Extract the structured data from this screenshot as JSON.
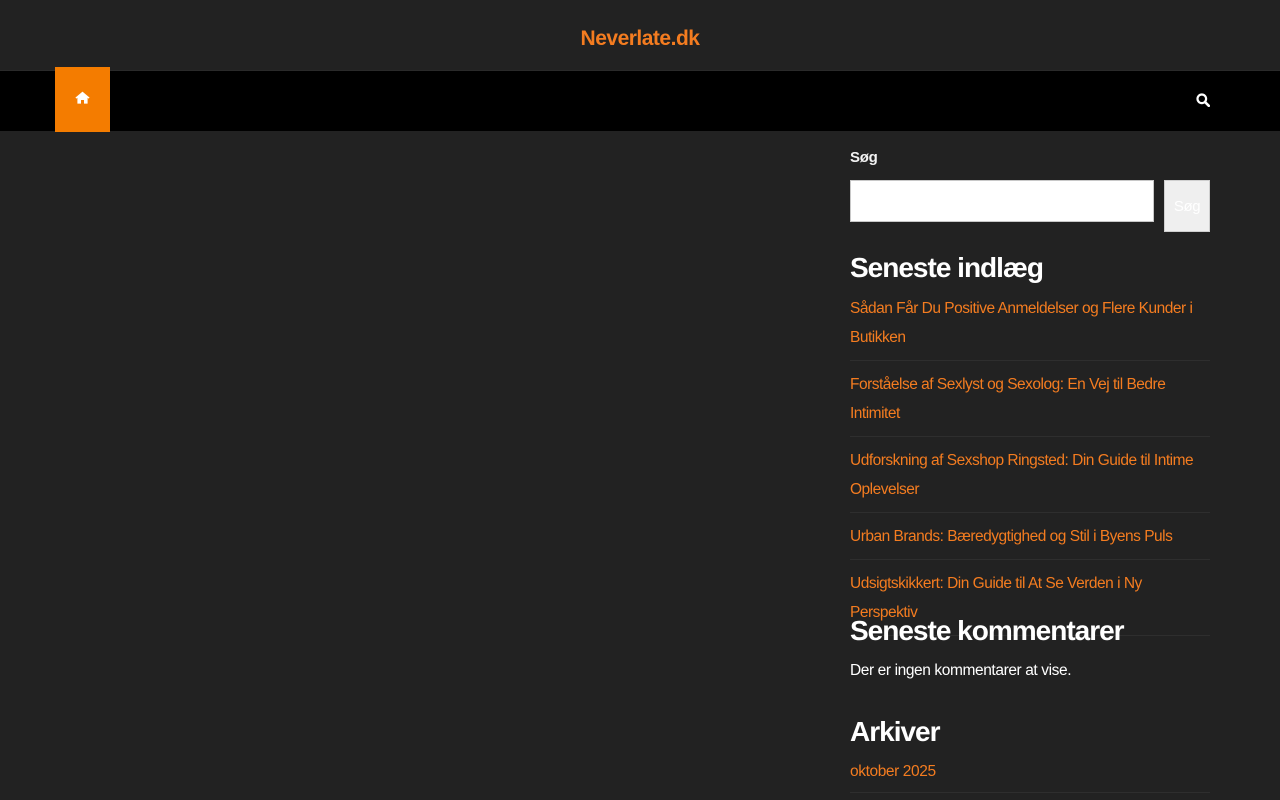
{
  "site": {
    "title": "Neverlate.dk",
    "accent_color": "#f47c20",
    "background_color": "#222222"
  },
  "nav": {
    "home_icon": "home-icon",
    "search_icon": "search-icon"
  },
  "sidebar": {
    "search": {
      "label": "Søg",
      "input_value": "",
      "submit_label": "Søg"
    },
    "recent_posts": {
      "title": "Seneste indlæg",
      "items": [
        {
          "label": "Sådan Får Du Positive Anmeldelser og Flere Kunder i Butikken"
        },
        {
          "label": "Forståelse af Sexlyst og Sexolog: En Vej til Bedre Intimitet"
        },
        {
          "label": "Udforskning af Sexshop Ringsted: Din Guide til Intime Oplevelser"
        },
        {
          "label": "Urban Brands: Bæredygtighed og Stil i Byens Puls"
        },
        {
          "label": "Udsigtskikkert: Din Guide til At Se Verden i Ny Perspektiv"
        }
      ]
    },
    "recent_comments": {
      "title": "Seneste kommentarer",
      "empty_text": "Der er ingen kommentarer at vise."
    },
    "archives": {
      "title": "Arkiver",
      "items": [
        {
          "label": "oktober 2025"
        }
      ]
    }
  }
}
